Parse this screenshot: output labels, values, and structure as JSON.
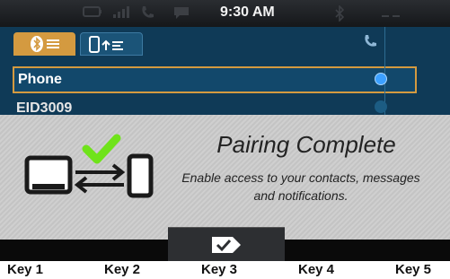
{
  "status_bar": {
    "time": "9:30 AM",
    "icons": [
      "battery-icon",
      "signal-icon",
      "phone-icon",
      "message-icon",
      "bluetooth-icon",
      "dash-icon"
    ]
  },
  "tabs": [
    {
      "name": "bluetooth-devices",
      "icon": "bluetooth-list-icon",
      "active": true
    },
    {
      "name": "phone-transfer",
      "icon": "phone-upload-icon",
      "active": false
    }
  ],
  "device_list": [
    {
      "label": "Phone",
      "selected": true
    },
    {
      "label": "EID3009",
      "selected": false
    }
  ],
  "popup": {
    "title": "Pairing Complete",
    "message_line1": "Enable access to your contacts, messages",
    "message_line2": "and notifications."
  },
  "confirm_button": {
    "icon": "check-tag-icon"
  },
  "keys": [
    "Key 1",
    "Key 2",
    "Key 3",
    "Key 4",
    "Key 5"
  ],
  "colors": {
    "accent": "#d49a40",
    "header_blue": "#0f3a57",
    "check_green": "#6fe31a"
  }
}
